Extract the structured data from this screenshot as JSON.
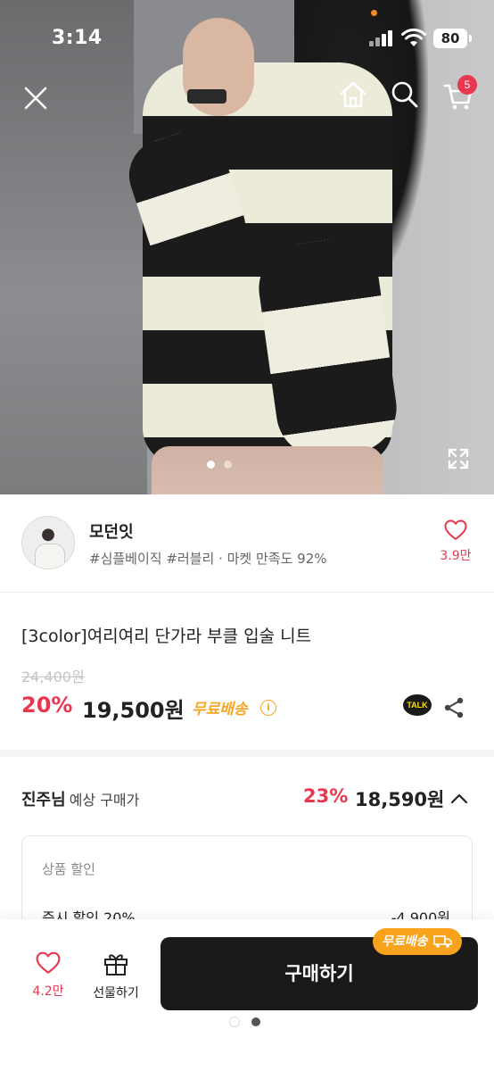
{
  "status": {
    "time": "3:14",
    "battery": "80"
  },
  "nav": {
    "cart_count": "5"
  },
  "gallery": {
    "page_count": 2,
    "active_index": 0
  },
  "store": {
    "name": "모던잇",
    "tags": "#심플베이직 #러블리 · 마켓 만족도 92%",
    "like_count": "3.9만"
  },
  "product": {
    "title": "[3color]여리여리 단가라 부클 입술 니트",
    "original_price": "24,400원",
    "discount_rate": "20%",
    "price": "19,500원",
    "shipping": "무료배송",
    "talk_label": "TALK"
  },
  "member": {
    "name": "진주님",
    "label": "예상 구매가",
    "discount_rate": "23%",
    "price": "18,590원"
  },
  "discount_detail": {
    "heading": "상품 할인",
    "row_label": "즉시 할인 20%",
    "row_value": "-4,900원"
  },
  "bottom": {
    "wish_count": "4.2만",
    "gift_label": "선물하기",
    "buy_label": "구매하기",
    "ship_badge": "무료배송"
  },
  "colors": {
    "accent": "#e8384f",
    "shipping": "#f5a623",
    "buy_button": "#1a1a1a"
  }
}
